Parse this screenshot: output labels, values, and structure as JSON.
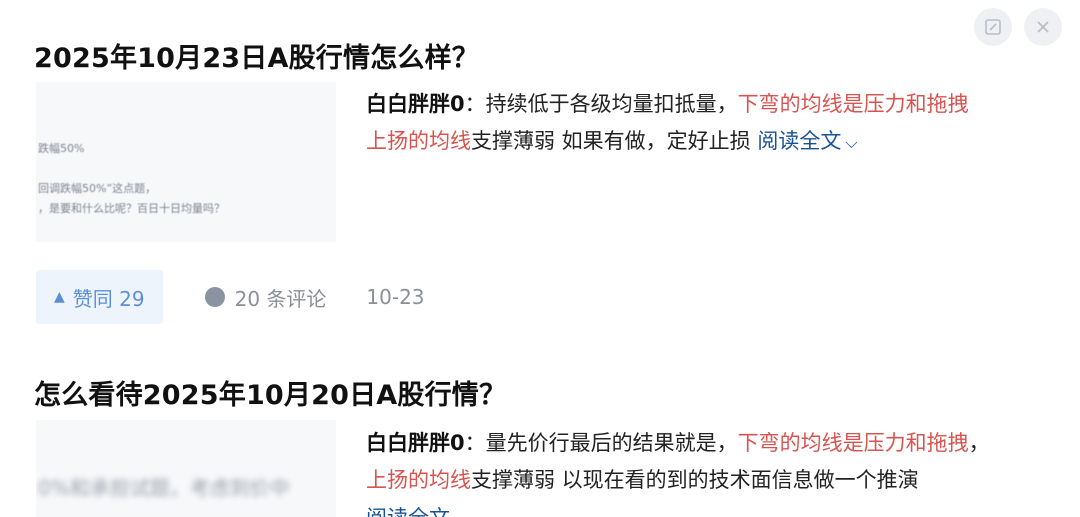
{
  "top_actions": {
    "edit_icon": "edit-icon",
    "close_icon": "close-icon"
  },
  "items": [
    {
      "title": "2025年10月23日A股行情怎么样？",
      "thumb_lines": [
        "跌幅50%",
        "回调跌幅50%”这点题，",
        "，是要和什么比呢？百日十日均量吗？"
      ],
      "author": "白白胖胖0",
      "sep": "：",
      "text_plain_1": "持续低于各级均量扣抵量，",
      "text_hl_1": "下弯的均线是压力和拖拽",
      "text_hl_2": "上扬的均线",
      "text_plain_2": "支撑薄弱 如果有做，定好止损 ",
      "read_more": "阅读全文",
      "like_label": "赞同 29",
      "comment_label": "20 条评论",
      "date": "10-23"
    },
    {
      "title": "怎么看待2025年10月20日A股行情？",
      "thumb_lines": [
        "0%和承担试题，考虑到价中"
      ],
      "author": "白白胖胖0",
      "sep": "：",
      "text_plain_1": "量先价行最后的结果就是，",
      "text_hl_1": "下弯的均线是压力和拖拽",
      "text_plain_1b": "，",
      "text_hl_2": "上扬的均线",
      "text_plain_2": "支撑薄弱 以现在看的到的技术面信息做一个推演",
      "read_more": "阅读全文"
    }
  ]
}
